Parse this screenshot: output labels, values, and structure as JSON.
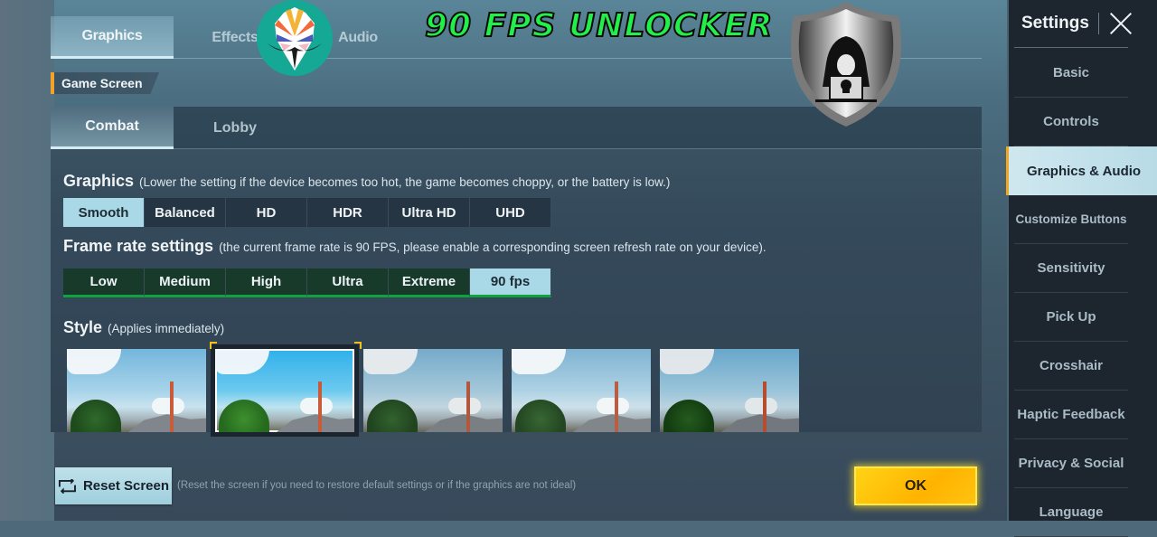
{
  "overlay": {
    "banner_text": "90 FPS UNLOCKER",
    "banner_color": "#22f04a"
  },
  "top_tabs": [
    {
      "label": "Graphics",
      "active": true
    },
    {
      "label": "Effects",
      "active": false
    },
    {
      "label": "Audio",
      "active": false
    }
  ],
  "section": {
    "label": "Game Screen"
  },
  "sub_tabs": [
    {
      "label": "Combat",
      "active": true
    },
    {
      "label": "Lobby",
      "active": false
    }
  ],
  "graphics": {
    "title": "Graphics",
    "hint": "(Lower the setting if the device becomes too hot, the game becomes choppy, or the battery is low.)",
    "options": [
      "Smooth",
      "Balanced",
      "HD",
      "HDR",
      "Ultra HD",
      "UHD"
    ],
    "selected": "Smooth"
  },
  "frame_rate": {
    "title": "Frame rate settings",
    "hint": "(the current frame rate is 90 FPS, please enable a corresponding screen refresh rate on your device).",
    "options": [
      "Low",
      "Medium",
      "High",
      "Ultra",
      "Extreme",
      "90 fps"
    ],
    "selected": "90 fps"
  },
  "style": {
    "title": "Style",
    "hint": "(Applies immediately)",
    "thumbnail_count": 5,
    "selected_index": 1
  },
  "footer": {
    "reset_label": "Reset Screen",
    "reset_hint": "(Reset the screen if you need to restore default settings or if the graphics are not ideal)",
    "ok_label": "OK"
  },
  "sidebar": {
    "title": "Settings",
    "items": [
      {
        "label": "Basic",
        "active": false
      },
      {
        "label": "Controls",
        "active": false
      },
      {
        "label": "Graphics & Audio",
        "active": true
      },
      {
        "label": "Customize Buttons",
        "active": false
      },
      {
        "label": "Sensitivity",
        "active": false
      },
      {
        "label": "Pick Up",
        "active": false
      },
      {
        "label": "Crosshair",
        "active": false
      },
      {
        "label": "Haptic Feedback",
        "active": false
      },
      {
        "label": "Privacy & Social",
        "active": false
      },
      {
        "label": "Language",
        "active": false
      }
    ]
  },
  "colors": {
    "accent_orange": "#f0a81e",
    "selected_option": "#a9d8e6",
    "framerate_green": "#0ea33c",
    "ok_yellow": "#ffc310"
  }
}
